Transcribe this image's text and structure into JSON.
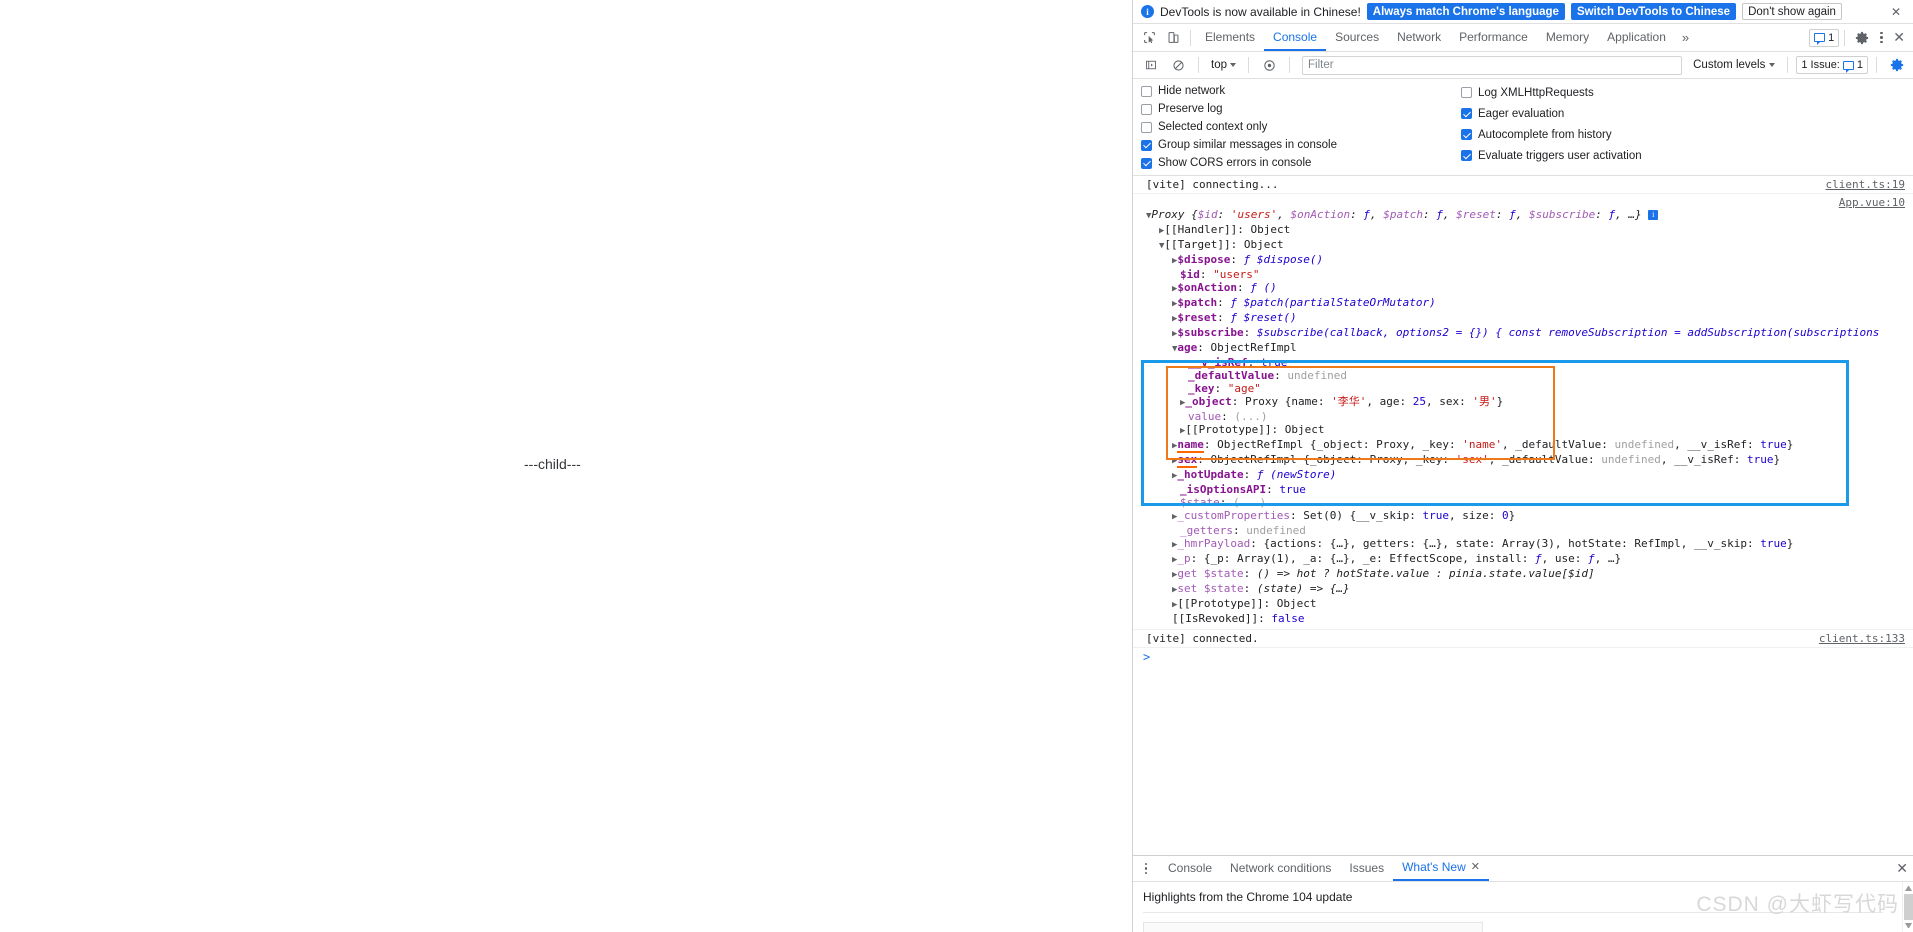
{
  "page": {
    "child_label": "---child---"
  },
  "notification": {
    "icon": "info-icon",
    "message": "DevTools is now available in Chinese!",
    "primary_button": "Always match Chrome's language",
    "secondary_button": "Switch DevTools to Chinese",
    "dismiss_button": "Don't show again",
    "close": "✕",
    "accent_color": "#1a73e8"
  },
  "toolbar": {
    "inspect_icon": "inspect-element-icon",
    "device_icon": "device-toolbar-icon",
    "tabs": [
      {
        "label": "Elements",
        "active": false
      },
      {
        "label": "Console",
        "active": true
      },
      {
        "label": "Sources",
        "active": false
      },
      {
        "label": "Network",
        "active": false
      },
      {
        "label": "Performance",
        "active": false
      },
      {
        "label": "Memory",
        "active": false
      },
      {
        "label": "Application",
        "active": false
      }
    ],
    "more_tabs": "»",
    "issue_count": "1",
    "settings_icon": "gear-icon",
    "kebab_icon": "more-options-icon",
    "close_icon": "close-icon"
  },
  "console_toolbar": {
    "sidebar_icon": "console-sidebar-icon",
    "clear_icon": "clear-console-icon",
    "context": "top",
    "eye_icon": "live-expression-icon",
    "filter_placeholder": "Filter",
    "filter_value": "",
    "levels_label": "Custom levels",
    "issues_label": "1 Issue:",
    "issues_count": "1",
    "settings_icon": "console-settings-gear-icon"
  },
  "console_settings": {
    "left": [
      {
        "label": "Hide network",
        "checked": false
      },
      {
        "label": "Preserve log",
        "checked": false
      },
      {
        "label": "Selected context only",
        "checked": false
      },
      {
        "label": "Group similar messages in console",
        "checked": true
      },
      {
        "label": "Show CORS errors in console",
        "checked": true
      }
    ],
    "right": [
      {
        "label": "Log XMLHttpRequests",
        "checked": false
      },
      {
        "label": "Eager evaluation",
        "checked": true
      },
      {
        "label": "Autocomplete from history",
        "checked": true
      },
      {
        "label": "Evaluate triggers user activation",
        "checked": true
      }
    ]
  },
  "console_output": {
    "first_message": "[vite] connecting...",
    "first_message_source": "client.ts:19",
    "object_source": "App.vue:10",
    "last_message": "[vite] connected.",
    "last_message_source": "client.ts:133",
    "prompt": ">",
    "lines": [
      "Proxy {$id: 'users', $onAction: ƒ, $patch: ƒ, $reset: ƒ, $subscribe: ƒ, …}",
      "[[Handler]]: Object",
      "[[Target]]: Object",
      "$dispose: ƒ $dispose()",
      "$id: \"users\"",
      "$onAction: ƒ ()",
      "$patch: ƒ $patch(partialStateOrMutator)",
      "$reset: ƒ $reset()",
      "$subscribe: $subscribe(callback, options2 = {}) { const removeSubscription = addSubscription(subscriptions",
      "age: ObjectRefImpl",
      "__v_isRef: true",
      "_defaultValue: undefined",
      "_key: \"age\"",
      "_object: Proxy {name: '李华', age: 25, sex: '男'}",
      "value: (...)",
      "[[Prototype]]: Object",
      "name: ObjectRefImpl {_object: Proxy, _key: 'name', _defaultValue: undefined, __v_isRef: true}",
      "sex: ObjectRefImpl {_object: Proxy, _key: 'sex', _defaultValue: undefined, __v_isRef: true}",
      "_hotUpdate: ƒ (newStore)",
      "_isOptionsAPI: true",
      "$state: (...)",
      "_customProperties: Set(0) {__v_skip: true, size: 0}",
      "_getters: undefined",
      "_hmrPayload: {actions: {…}, getters: {…}, state: Array(3), hotState: RefImpl, __v_skip: true}",
      "_p: {_p: Array(1), _a: {…}, _e: EffectScope, install: ƒ, use: ƒ, …}",
      "get $state: () => hot ? hotState.value : pinia.state.value[$id]",
      "set $state: (state) => {…}",
      "[[Prototype]]: Object",
      "[[IsRevoked]]: false"
    ],
    "object_values": {
      "store_id": "users",
      "ref_key_age": "age",
      "proxy_name": "李华",
      "proxy_age": "25",
      "proxy_sex": "男",
      "v_isRef": "true",
      "defaultValue": "undefined",
      "isOptionsAPI": "true",
      "isRevoked": "false",
      "customProperties_size": "0",
      "hmr_state": "Array(3)"
    }
  },
  "annotations": {
    "blue_box_color": "#1a9ae8",
    "orange_box_color": "#f07818",
    "underline_color": "#ff6600"
  },
  "drawer": {
    "kebab_icon": "drawer-more-options-icon",
    "tabs": [
      {
        "label": "Console",
        "active": false,
        "closable": false
      },
      {
        "label": "Network conditions",
        "active": false,
        "closable": false
      },
      {
        "label": "Issues",
        "active": false,
        "closable": false
      },
      {
        "label": "What's New",
        "active": true,
        "closable": true
      }
    ],
    "close_tab_icon": "✕",
    "close_drawer_icon": "✕",
    "content_title": "Highlights from the Chrome 104 update"
  },
  "watermark": {
    "text": "CSDN @大虾写代码"
  }
}
